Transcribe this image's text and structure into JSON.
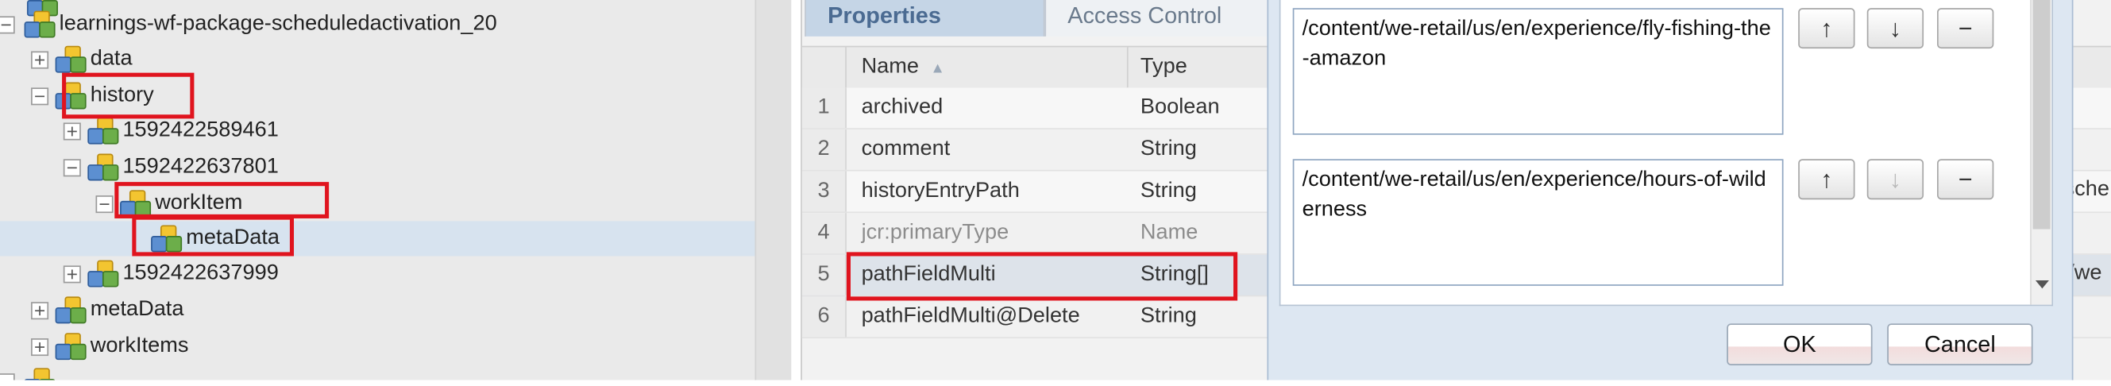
{
  "tree": {
    "nodes": [
      {
        "label": "learnings-wf-package-scheduledactivation_20",
        "expander": "minus"
      },
      {
        "label": "data",
        "expander": "plus"
      },
      {
        "label": "history",
        "expander": "minus"
      },
      {
        "label": "1592422589461",
        "expander": "plus"
      },
      {
        "label": "1592422637801",
        "expander": "minus"
      },
      {
        "label": "workItem",
        "expander": "minus"
      },
      {
        "label": "metaData",
        "expander": "none",
        "selected": true
      },
      {
        "label": "1592422637999",
        "expander": "plus"
      },
      {
        "label": "metaData",
        "expander": "plus"
      },
      {
        "label": "workItems",
        "expander": "plus"
      }
    ]
  },
  "properties": {
    "tabs": {
      "properties": "Properties",
      "access_control": "Access Control"
    },
    "columns": {
      "name": "Name",
      "sort_indicator": "▲",
      "type": "Type"
    },
    "rows": [
      {
        "num": "1",
        "name": "archived",
        "type": "Boolean"
      },
      {
        "num": "2",
        "name": "comment",
        "type": "String"
      },
      {
        "num": "3",
        "name": "historyEntryPath",
        "type": "String"
      },
      {
        "num": "4",
        "name": "jcr:primaryType",
        "type": "Name"
      },
      {
        "num": "5",
        "name": "pathFieldMulti",
        "type": "String[]"
      },
      {
        "num": "6",
        "name": "pathFieldMulti@Delete",
        "type": "String"
      }
    ],
    "overflow_values": {
      "row3": "sche.",
      "row5": "nt/we"
    }
  },
  "dialog": {
    "fields": [
      {
        "value": "/content/we-retail/us/en/experience/fly-fishing-the-amazon"
      },
      {
        "value": "/content/we-retail/us/en/experience/hours-of-wilderness"
      }
    ],
    "buttons": {
      "up": "↑",
      "down": "↓",
      "remove": "−",
      "ok": "OK",
      "cancel": "Cancel"
    }
  },
  "colors": {
    "highlight": "#e0141e",
    "tab_active": "#4b6b92",
    "selection": "#d7e3ef"
  }
}
